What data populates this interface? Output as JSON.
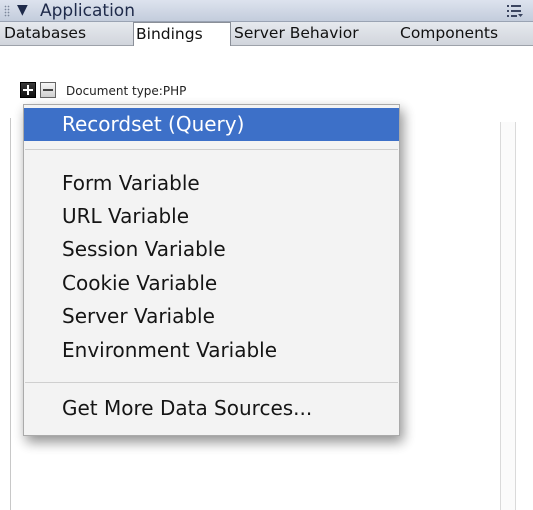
{
  "panel": {
    "title": "Application",
    "collapse_glyph": "▼",
    "options_icon": "panel-options-icon"
  },
  "tabs": [
    {
      "label": "Databases",
      "active": false
    },
    {
      "label": "Bindings",
      "active": true
    },
    {
      "label": "Server Behavior",
      "active": false
    },
    {
      "label": "Components",
      "active": false
    }
  ],
  "toolbar": {
    "add_icon": "plus-icon",
    "remove_icon": "minus-icon",
    "document_type": "Document type:PHP"
  },
  "menu": {
    "items": [
      {
        "label": "Recordset (Query)",
        "highlighted": true
      },
      {
        "label": "Form Variable",
        "highlighted": false
      },
      {
        "label": "URL Variable",
        "highlighted": false
      },
      {
        "label": "Session Variable",
        "highlighted": false
      },
      {
        "label": "Cookie Variable",
        "highlighted": false
      },
      {
        "label": "Server Variable",
        "highlighted": false
      },
      {
        "label": "Environment Variable",
        "highlighted": false
      },
      {
        "label": "Get More Data Sources...",
        "highlighted": false
      }
    ]
  },
  "colors": {
    "highlight": "#3a6ec7",
    "titlebar": "#c3ccdc"
  }
}
